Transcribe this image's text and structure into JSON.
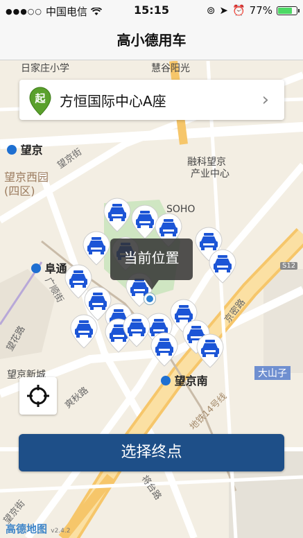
{
  "status_bar": {
    "signal": "●●●○○",
    "carrier": "中国电信",
    "time": "15:15",
    "battery_percent": 77,
    "battery_text": "77%"
  },
  "nav": {
    "title": "高小德用车"
  },
  "start": {
    "label": "方恒国际中心A座",
    "badge": "起"
  },
  "map_labels": {
    "wangjing": "望京",
    "wangjingxiyuan": "望京西园",
    "siqu": "(四区)",
    "futong": "阜通",
    "wangjingxincheng": "望京新城",
    "wangjingnan": "望京南",
    "dashanzi": "大山子",
    "rongke": "融科望京",
    "chanye": "产业中心",
    "huiguyangguang": "慧谷阳光",
    "rijiazhuang": "日家庄小学",
    "wangjingjie": "望京街",
    "wanghualu": "望花路",
    "guangshunjie": "广顺街",
    "shuangqiulu": "爽秋路",
    "jingmilu": "京密路",
    "subway14": "地铁14号线",
    "jiangtailu": "将台路",
    "wangjingjie2": "望京街",
    "soho": "SOHO",
    "s12": "S12"
  },
  "tooltip": {
    "label": "当前位置"
  },
  "locate_button": {
    "icon": "crosshair-icon"
  },
  "select_button": {
    "label": "选择终点"
  },
  "logo": {
    "name": "高德地图",
    "version": "v2.4.2"
  },
  "colors": {
    "accent": "#1e4f88",
    "taxi": "#1c55d6",
    "start_pin": "#5aa02c"
  }
}
